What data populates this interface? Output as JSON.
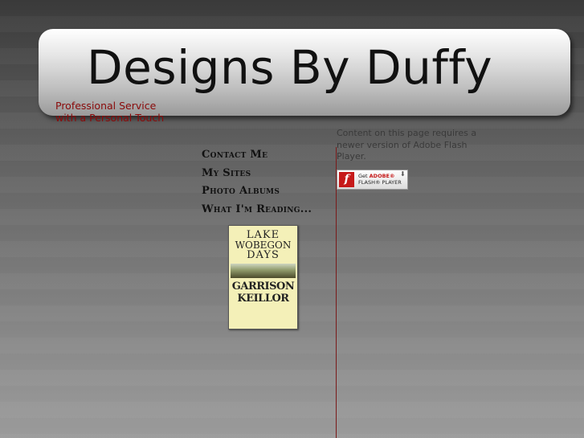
{
  "header": {
    "title": "Designs By Duffy"
  },
  "tagline": {
    "line1": "Professional Service",
    "line2": "with a Personal Touch"
  },
  "nav": {
    "items": [
      {
        "label": "Contact Me"
      },
      {
        "label": "My Sites"
      },
      {
        "label": "Photo Albums"
      },
      {
        "label": "What I'm Reading..."
      }
    ]
  },
  "book": {
    "line1": "LAKE",
    "line2": "WOBEGON",
    "line3": "DAYS",
    "line4": "GARRISON",
    "line5": "KEILLOR"
  },
  "flash": {
    "message": "Content on this page requires a newer version of Adobe Flash Player.",
    "button_icon": "flash-logo-icon",
    "button_logo": "f",
    "button_line1_prefix": "Get ",
    "button_line1_brand": "ADOBE®",
    "button_line2": "FLASH® PLAYER",
    "download_glyph": "⬇"
  },
  "colors": {
    "tagline": "#8a0a0a",
    "divider": "#7a1a1a",
    "flash_red": "#c61a1a"
  }
}
